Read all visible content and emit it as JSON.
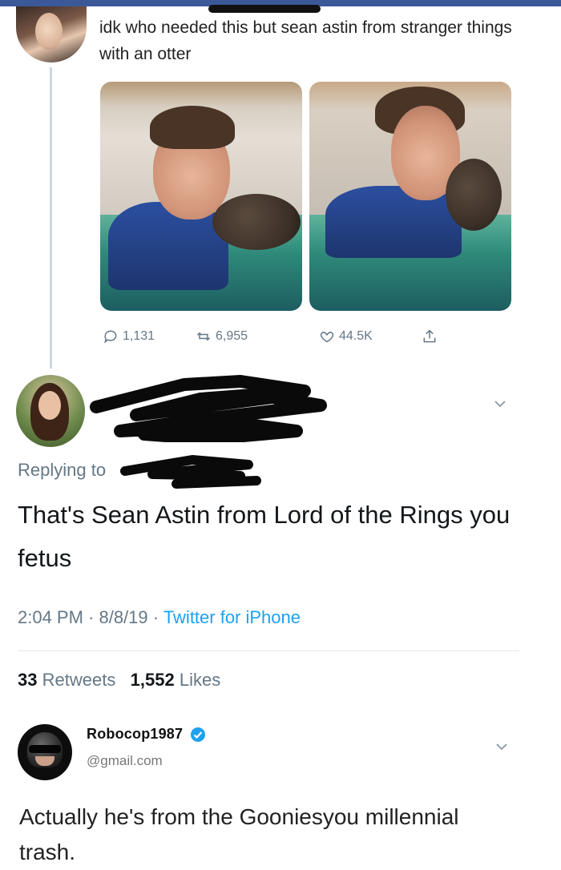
{
  "tweet1": {
    "text": "idk who needed this but sean astin from stranger things with an otter",
    "actions": {
      "reply_count": "1,131",
      "retweet_count": "6,955",
      "like_count": "44.5K"
    }
  },
  "tweet2": {
    "replying_label": "Replying to",
    "text": "That's Sean Astin from Lord of the Rings you fetus",
    "timestamp": "2:04 PM · 8/8/19 · ",
    "source": "Twitter for iPhone",
    "stats": {
      "retweets_count": "33",
      "retweets_label": "Retweets",
      "likes_count": "1,552",
      "likes_label": "Likes"
    }
  },
  "tweet3": {
    "display_name": "Robocop1987",
    "handle": "@gmail.com",
    "text": "Actually he's from the Gooniesyou millennial trash."
  },
  "colors": {
    "facebook_bar": "#3b5998",
    "muted_text": "#657786",
    "link_blue": "#1da1f2"
  },
  "icons": [
    "reply-icon",
    "retweet-icon",
    "like-icon",
    "share-icon",
    "chevron-down-icon",
    "verified-badge-icon"
  ]
}
